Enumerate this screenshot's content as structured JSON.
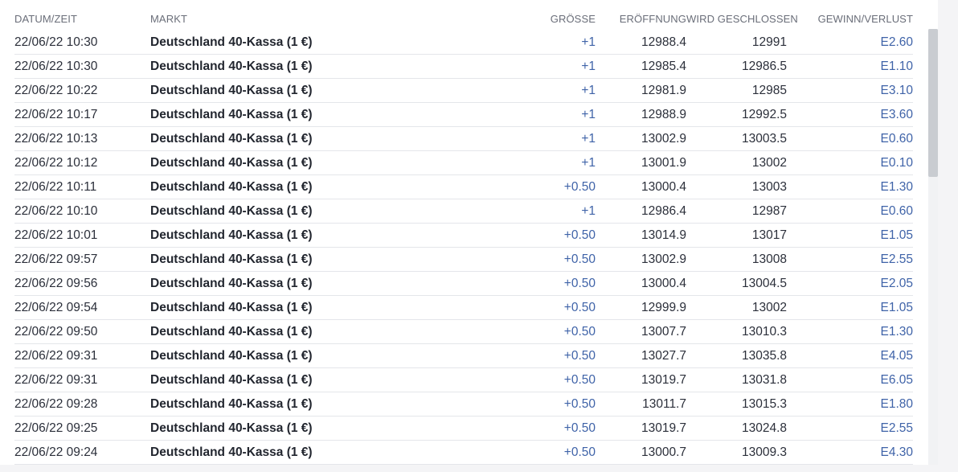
{
  "table": {
    "headers": {
      "date": "DATUM/ZEIT",
      "market": "MARKT",
      "size": "GRÖSSE",
      "open": "ERÖFFNUNG",
      "close": "WIRD GESCHLOSSEN",
      "pl": "GEWINN/VERLUST"
    },
    "rows": [
      {
        "date": "22/06/22 10:30",
        "market": "Deutschland 40-Kassa (1 €)",
        "size": "+1",
        "open": "12988.4",
        "close": "12991",
        "pl": "E2.60"
      },
      {
        "date": "22/06/22 10:30",
        "market": "Deutschland 40-Kassa (1 €)",
        "size": "+1",
        "open": "12985.4",
        "close": "12986.5",
        "pl": "E1.10"
      },
      {
        "date": "22/06/22 10:22",
        "market": "Deutschland 40-Kassa (1 €)",
        "size": "+1",
        "open": "12981.9",
        "close": "12985",
        "pl": "E3.10"
      },
      {
        "date": "22/06/22 10:17",
        "market": "Deutschland 40-Kassa (1 €)",
        "size": "+1",
        "open": "12988.9",
        "close": "12992.5",
        "pl": "E3.60"
      },
      {
        "date": "22/06/22 10:13",
        "market": "Deutschland 40-Kassa (1 €)",
        "size": "+1",
        "open": "13002.9",
        "close": "13003.5",
        "pl": "E0.60"
      },
      {
        "date": "22/06/22 10:12",
        "market": "Deutschland 40-Kassa (1 €)",
        "size": "+1",
        "open": "13001.9",
        "close": "13002",
        "pl": "E0.10"
      },
      {
        "date": "22/06/22 10:11",
        "market": "Deutschland 40-Kassa (1 €)",
        "size": "+0.50",
        "open": "13000.4",
        "close": "13003",
        "pl": "E1.30"
      },
      {
        "date": "22/06/22 10:10",
        "market": "Deutschland 40-Kassa (1 €)",
        "size": "+1",
        "open": "12986.4",
        "close": "12987",
        "pl": "E0.60"
      },
      {
        "date": "22/06/22 10:01",
        "market": "Deutschland 40-Kassa (1 €)",
        "size": "+0.50",
        "open": "13014.9",
        "close": "13017",
        "pl": "E1.05"
      },
      {
        "date": "22/06/22 09:57",
        "market": "Deutschland 40-Kassa (1 €)",
        "size": "+0.50",
        "open": "13002.9",
        "close": "13008",
        "pl": "E2.55"
      },
      {
        "date": "22/06/22 09:56",
        "market": "Deutschland 40-Kassa (1 €)",
        "size": "+0.50",
        "open": "13000.4",
        "close": "13004.5",
        "pl": "E2.05"
      },
      {
        "date": "22/06/22 09:54",
        "market": "Deutschland 40-Kassa (1 €)",
        "size": "+0.50",
        "open": "12999.9",
        "close": "13002",
        "pl": "E1.05"
      },
      {
        "date": "22/06/22 09:50",
        "market": "Deutschland 40-Kassa (1 €)",
        "size": "+0.50",
        "open": "13007.7",
        "close": "13010.3",
        "pl": "E1.30"
      },
      {
        "date": "22/06/22 09:31",
        "market": "Deutschland 40-Kassa (1 €)",
        "size": "+0.50",
        "open": "13027.7",
        "close": "13035.8",
        "pl": "E4.05"
      },
      {
        "date": "22/06/22 09:31",
        "market": "Deutschland 40-Kassa (1 €)",
        "size": "+0.50",
        "open": "13019.7",
        "close": "13031.8",
        "pl": "E6.05"
      },
      {
        "date": "22/06/22 09:28",
        "market": "Deutschland 40-Kassa (1 €)",
        "size": "+0.50",
        "open": "13011.7",
        "close": "13015.3",
        "pl": "E1.80"
      },
      {
        "date": "22/06/22 09:25",
        "market": "Deutschland 40-Kassa (1 €)",
        "size": "+0.50",
        "open": "13019.7",
        "close": "13024.8",
        "pl": "E2.55"
      },
      {
        "date": "22/06/22 09:24",
        "market": "Deutschland 40-Kassa (1 €)",
        "size": "+0.50",
        "open": "13000.7",
        "close": "13009.3",
        "pl": "E4.30"
      }
    ]
  },
  "colors": {
    "accent": "#3f63a8",
    "header_text": "#6a6e79",
    "row_divider": "#e4e6ea"
  }
}
